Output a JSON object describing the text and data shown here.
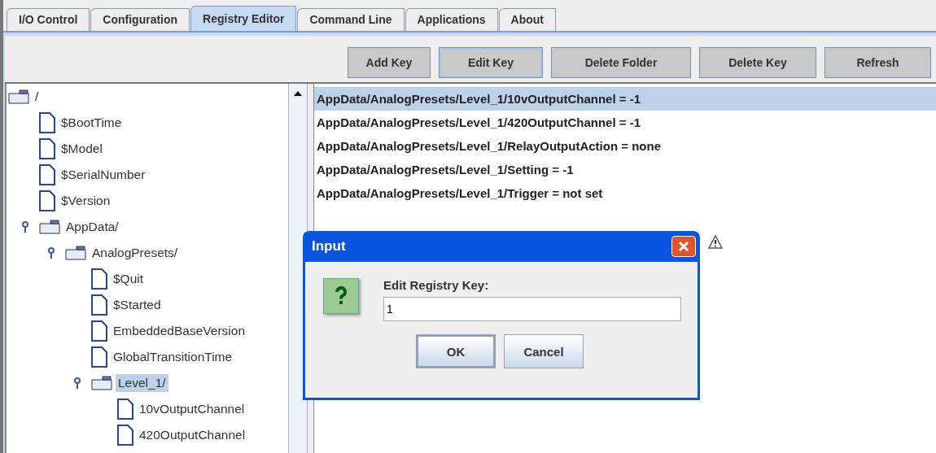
{
  "tabs": [
    {
      "label": "I/O Control",
      "selected": false
    },
    {
      "label": "Configuration",
      "selected": false
    },
    {
      "label": "Registry Editor",
      "selected": true
    },
    {
      "label": "Command Line",
      "selected": false
    },
    {
      "label": "Applications",
      "selected": false
    },
    {
      "label": "About",
      "selected": false
    }
  ],
  "toolbar": [
    {
      "label": "Add Key",
      "focused": false
    },
    {
      "label": "Edit Key",
      "focused": true
    },
    {
      "label": "Delete Folder",
      "focused": false
    },
    {
      "label": "Delete Key",
      "focused": false
    },
    {
      "label": "Refresh",
      "focused": false
    }
  ],
  "tree": [
    {
      "label": "/",
      "kind": "folder",
      "selected": false,
      "children": [
        {
          "label": "$BootTime",
          "kind": "file",
          "selected": false
        },
        {
          "label": "$Model",
          "kind": "file",
          "selected": false
        },
        {
          "label": "$SerialNumber",
          "kind": "file",
          "selected": false
        },
        {
          "label": "$Version",
          "kind": "file",
          "selected": false
        },
        {
          "label": "AppData/",
          "kind": "folder",
          "selected": false,
          "expanded": true,
          "children": [
            {
              "label": "AnalogPresets/",
              "kind": "folder",
              "selected": false,
              "expanded": true,
              "children": [
                {
                  "label": "$Quit",
                  "kind": "file",
                  "selected": false
                },
                {
                  "label": "$Started",
                  "kind": "file",
                  "selected": false
                },
                {
                  "label": "EmbeddedBaseVersion",
                  "kind": "file",
                  "selected": false
                },
                {
                  "label": "GlobalTransitionTime",
                  "kind": "file",
                  "selected": false
                },
                {
                  "label": "Level_1/",
                  "kind": "folder",
                  "selected": true,
                  "expanded": true,
                  "children": [
                    {
                      "label": "10vOutputChannel",
                      "kind": "file",
                      "selected": false
                    },
                    {
                      "label": "420OutputChannel",
                      "kind": "file",
                      "selected": false
                    }
                  ]
                }
              ]
            }
          ]
        }
      ]
    }
  ],
  "entries": [
    {
      "text": "AppData/AnalogPresets/Level_1/10vOutputChannel = -1",
      "selected": true
    },
    {
      "text": "AppData/AnalogPresets/Level_1/420OutputChannel = -1",
      "selected": false
    },
    {
      "text": "AppData/AnalogPresets/Level_1/RelayOutputAction = none",
      "selected": false
    },
    {
      "text": "AppData/AnalogPresets/Level_1/Setting = -1",
      "selected": false
    },
    {
      "text": "AppData/AnalogPresets/Level_1/Trigger = not set",
      "selected": false
    }
  ],
  "dialog": {
    "title": "Input",
    "prompt": "Edit Registry Key:",
    "value": "1",
    "buttons": [
      {
        "label": "OK",
        "focused": true
      },
      {
        "label": "Cancel",
        "focused": false
      }
    ]
  }
}
